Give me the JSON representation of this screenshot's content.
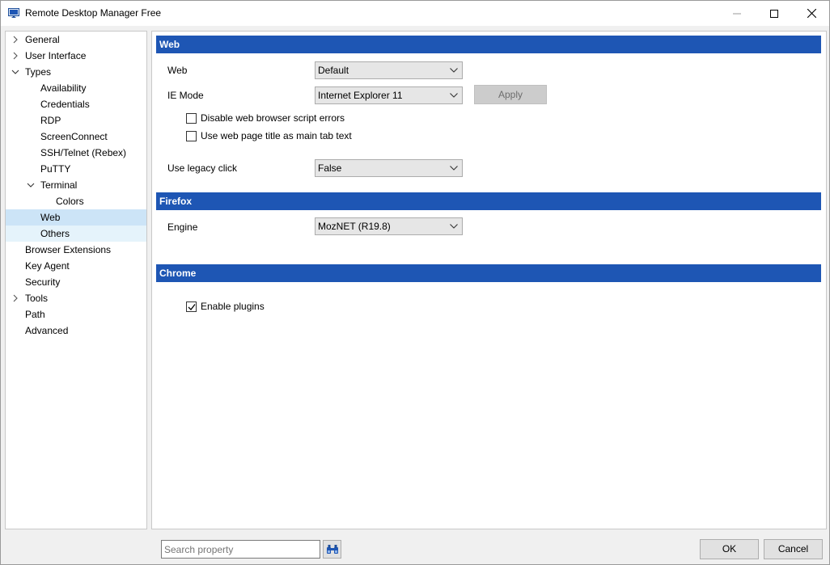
{
  "window": {
    "title": "Remote Desktop Manager Free"
  },
  "tree": {
    "items": [
      {
        "label": "General",
        "has_chevron": true,
        "expanded": false
      },
      {
        "label": "User Interface",
        "has_chevron": true,
        "expanded": false
      },
      {
        "label": "Types",
        "has_chevron": true,
        "expanded": true
      },
      {
        "label": "Availability"
      },
      {
        "label": "Credentials"
      },
      {
        "label": "RDP"
      },
      {
        "label": "ScreenConnect"
      },
      {
        "label": "SSH/Telnet (Rebex)"
      },
      {
        "label": "PuTTY"
      },
      {
        "label": "Terminal",
        "has_chevron": true,
        "expanded": true
      },
      {
        "label": "Colors"
      },
      {
        "label": "Web",
        "selected": true
      },
      {
        "label": "Others",
        "hover": true
      },
      {
        "label": "Browser Extensions"
      },
      {
        "label": "Key Agent"
      },
      {
        "label": "Security"
      },
      {
        "label": "Tools",
        "has_chevron": true,
        "expanded": false
      },
      {
        "label": "Path"
      },
      {
        "label": "Advanced"
      }
    ]
  },
  "sections": {
    "web": {
      "header": "Web",
      "web_label": "Web",
      "web_value": "Default",
      "ie_mode_label": "IE Mode",
      "ie_mode_value": "Internet Explorer 11",
      "apply_label": "Apply",
      "disable_script_errors_label": "Disable web browser script errors",
      "disable_script_errors_checked": false,
      "use_page_title_label": "Use web page title as main tab text",
      "use_page_title_checked": false,
      "legacy_click_label": "Use legacy click",
      "legacy_click_value": "False"
    },
    "firefox": {
      "header": "Firefox",
      "engine_label": "Engine",
      "engine_value": "MozNET (R19.8)"
    },
    "chrome": {
      "header": "Chrome",
      "enable_plugins_label": "Enable plugins",
      "enable_plugins_checked": true
    }
  },
  "footer": {
    "search_placeholder": "Search property",
    "ok_label": "OK",
    "cancel_label": "Cancel"
  },
  "colors": {
    "section_header": "#1e56b4",
    "selected_item": "#cce4f7",
    "hover_item": "#e5f3fb"
  },
  "icons": {
    "app": "remote-desktop-icon",
    "search": "binoculars-icon",
    "expand": "chevron-right-icon",
    "collapse": "chevron-down-icon"
  }
}
